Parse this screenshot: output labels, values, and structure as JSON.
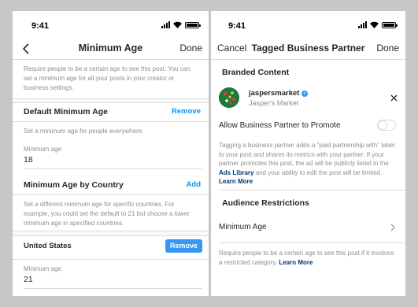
{
  "left": {
    "status_time": "9:41",
    "nav": {
      "title": "Minimum Age",
      "done": "Done"
    },
    "intro": "Require people to be a certain age to see this post. You can set a minimum age for all your posts in your creator or business settings.",
    "default_section": {
      "title": "Default Minimum Age",
      "action": "Remove",
      "desc": "Set a minimum age for people everywhere.",
      "field_label": "Minimum age",
      "field_value": "18"
    },
    "country_section": {
      "title": "Minimum Age by Country",
      "action": "Add",
      "desc": "Set a different minimum age for specific countries. For example, you could set the default to 21 but choose a lower minimum age in specified countries."
    },
    "country_entry": {
      "country": "United States",
      "remove": "Remove",
      "field_label": "Minimum age",
      "field_value": "21"
    }
  },
  "right": {
    "status_time": "9:41",
    "nav": {
      "cancel": "Cancel",
      "title": "Tagged Business Partner",
      "done": "Done"
    },
    "branded": {
      "title": "Branded Content",
      "partner_username": "jaspersmarket",
      "partner_name": "Jasper's Market",
      "toggle_label": "Allow Business Partner to Promote",
      "toggle_on": false,
      "desc_part1": "Tagging a business partner adds a \"paid partnership with\" label to your post and shares its metrics with your partner. If your partner promotes this post, the ad will be publicly listed in the",
      "ads_library": "Ads Library",
      "desc_part2": "and your ability to edit the post will be limited.",
      "learn_more": "Learn More"
    },
    "audience": {
      "title": "Audience Restrictions",
      "row_label": "Minimum Age",
      "desc": "Require people to be a certain age to see this post if it involves a restricted category.",
      "learn_more": "Learn More"
    }
  },
  "colors": {
    "accent": "#0095f6",
    "button": "#3897f0",
    "background": "#c7c7c7"
  },
  "icons": [
    "back-arrow-icon",
    "chevron-right-icon",
    "close-icon",
    "verified-badge-icon",
    "signal-icon",
    "wifi-icon",
    "battery-icon"
  ]
}
